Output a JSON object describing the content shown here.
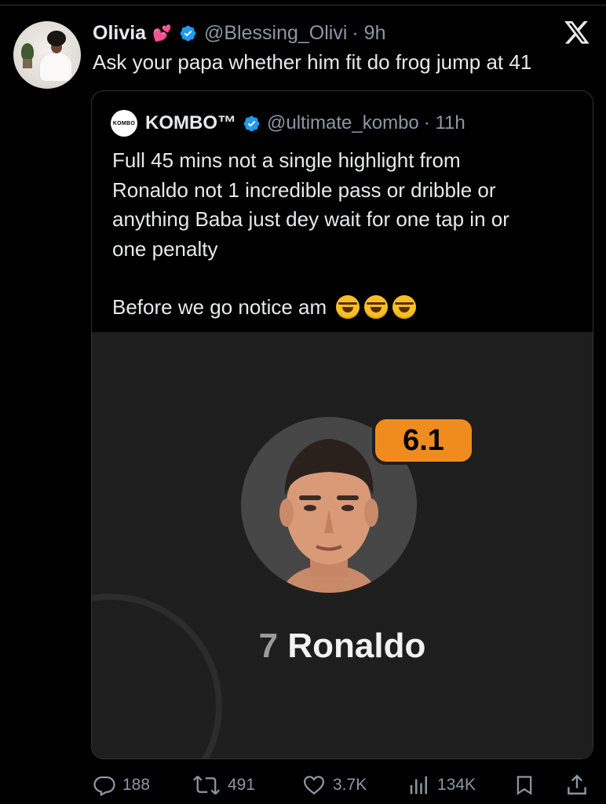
{
  "tweet": {
    "author_name": "Olivia",
    "author_emoji": "💕",
    "handle": "@Blessing_Olivi",
    "time": "· 9h",
    "text": "Ask your papa whether him fit do frog jump at 41"
  },
  "quoted": {
    "avatar_text": "KOMBO",
    "author_name": "KOMBO™",
    "handle": "@ultimate_kombo",
    "time": "· 11h",
    "text_lines": [
      "Full 45 mins not a single highlight from",
      "Ronaldo not 1 incredible pass or dribble or",
      "anything Baba just dey wait for one tap in or",
      "one penalty"
    ],
    "text_last": "Before we go notice am",
    "media": {
      "rating": "6.1",
      "player_number": "7",
      "player_name": "Ronaldo",
      "rating_color": "#f08c1e"
    }
  },
  "actions": {
    "replies": "188",
    "retweets": "491",
    "likes": "3.7K",
    "views": "134K"
  },
  "icons": {
    "verified": "verified-badge-icon",
    "platform": "x-logo-icon",
    "reply": "reply-icon",
    "retweet": "retweet-icon",
    "like": "heart-icon",
    "views": "views-icon",
    "bookmark": "bookmark-icon",
    "share": "share-icon",
    "laugh": "rolling-on-floor-laughing-emoji"
  },
  "colors": {
    "background": "#000000",
    "text": "#e7e9ea",
    "secondary": "#8b98a5",
    "verified": "#1d9bf0",
    "border": "#2f3336"
  }
}
